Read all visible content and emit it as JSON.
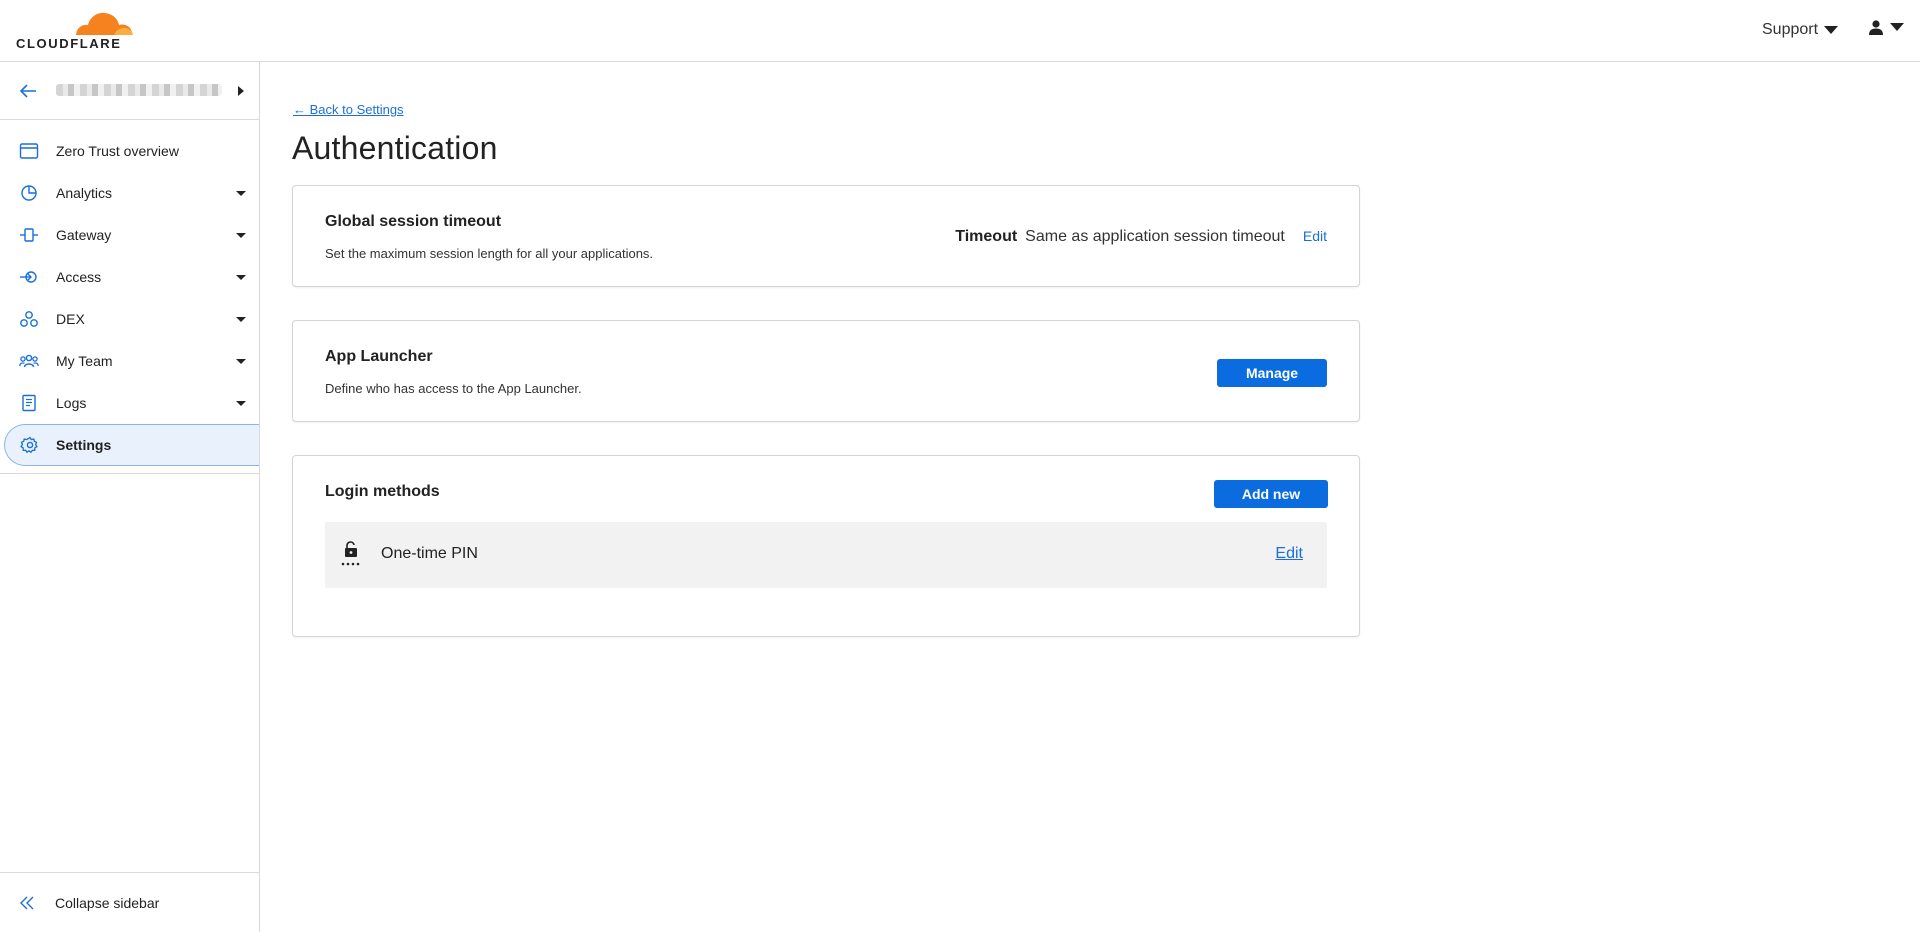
{
  "brand": {
    "name": "CLOUDFLARE",
    "accent": "#f6821f"
  },
  "header": {
    "support_label": "Support",
    "user_icon": "user-icon"
  },
  "sidebar": {
    "account_name": "",
    "items": [
      {
        "label": "Zero Trust overview",
        "icon": "browser-window-icon",
        "has_submenu": false
      },
      {
        "label": "Analytics",
        "icon": "pie-chart-icon",
        "has_submenu": true
      },
      {
        "label": "Gateway",
        "icon": "gateway-icon",
        "has_submenu": true
      },
      {
        "label": "Access",
        "icon": "access-icon",
        "has_submenu": true
      },
      {
        "label": "DEX",
        "icon": "dex-icon",
        "has_submenu": true
      },
      {
        "label": "My Team",
        "icon": "team-icon",
        "has_submenu": true
      },
      {
        "label": "Logs",
        "icon": "logs-icon",
        "has_submenu": true
      },
      {
        "label": "Settings",
        "icon": "gear-icon",
        "has_submenu": false,
        "active": true
      }
    ],
    "collapse_label": "Collapse sidebar"
  },
  "main": {
    "back_link": "← Back to Settings",
    "title": "Authentication",
    "session_card": {
      "title": "Global session timeout",
      "description": "Set the maximum session length for all your applications.",
      "timeout_label": "Timeout",
      "timeout_value": "Same as application session timeout",
      "edit_label": "Edit"
    },
    "launcher_card": {
      "title": "App Launcher",
      "description": "Define who has access to the App Launcher.",
      "button_label": "Manage"
    },
    "login_card": {
      "title": "Login methods",
      "button_label": "Add new",
      "methods": [
        {
          "name": "One-time PIN",
          "icon": "lock-pin-icon",
          "edit_label": "Edit"
        }
      ]
    }
  },
  "colors": {
    "primary": "#0b6ce0",
    "link": "#1a6fd8",
    "active_bg": "#e8f1fc"
  }
}
